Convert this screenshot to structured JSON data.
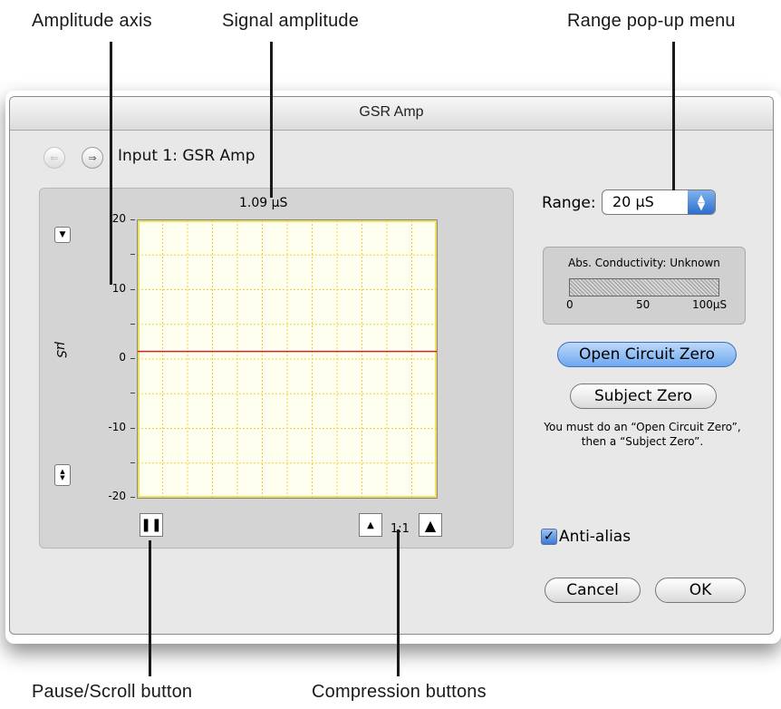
{
  "callouts": {
    "amplitude_axis": "Amplitude axis",
    "signal_amplitude": "Signal amplitude",
    "range_popup_menu": "Range pop-up menu",
    "pause_scroll_button": "Pause/Scroll button",
    "compression_buttons": "Compression buttons"
  },
  "window": {
    "title": "GSR Amp"
  },
  "nav": {
    "back_icon": "arrow-left-icon",
    "forward_icon": "arrow-right-icon",
    "input_label": "Input 1: GSR Amp"
  },
  "graph": {
    "amplitude_readout": "1.09 µS",
    "y_unit": "µS",
    "y_ticks": [
      "20",
      "10",
      "0",
      "-10",
      "-20"
    ],
    "compression_ratio": "1:1",
    "signal_color": "#e02020",
    "grid_color": "#f0d040"
  },
  "chart_data": {
    "type": "line",
    "xlabel": "",
    "ylabel": "µS",
    "ylim": [
      -20,
      20
    ],
    "y_ticks": [
      20,
      10,
      0,
      -10,
      -20
    ],
    "series": [
      {
        "values": [
          1.09,
          1.09
        ]
      }
    ]
  },
  "range": {
    "label": "Range:",
    "selected": "20 µS"
  },
  "conductivity": {
    "title": "Abs. Conductivity: Unknown",
    "scale_min": "0",
    "scale_mid": "50",
    "scale_max": "100µS"
  },
  "buttons": {
    "open_circuit_zero": "Open Circuit Zero",
    "subject_zero": "Subject Zero",
    "cancel": "Cancel",
    "ok": "OK"
  },
  "instructions": "You must do an “Open Circuit Zero”, then a “Subject Zero”.",
  "anti_alias": {
    "label": "Anti-alias",
    "checked": true
  },
  "colors": {
    "accent": "#3b78d8",
    "window_bg": "#e8e8e8"
  }
}
